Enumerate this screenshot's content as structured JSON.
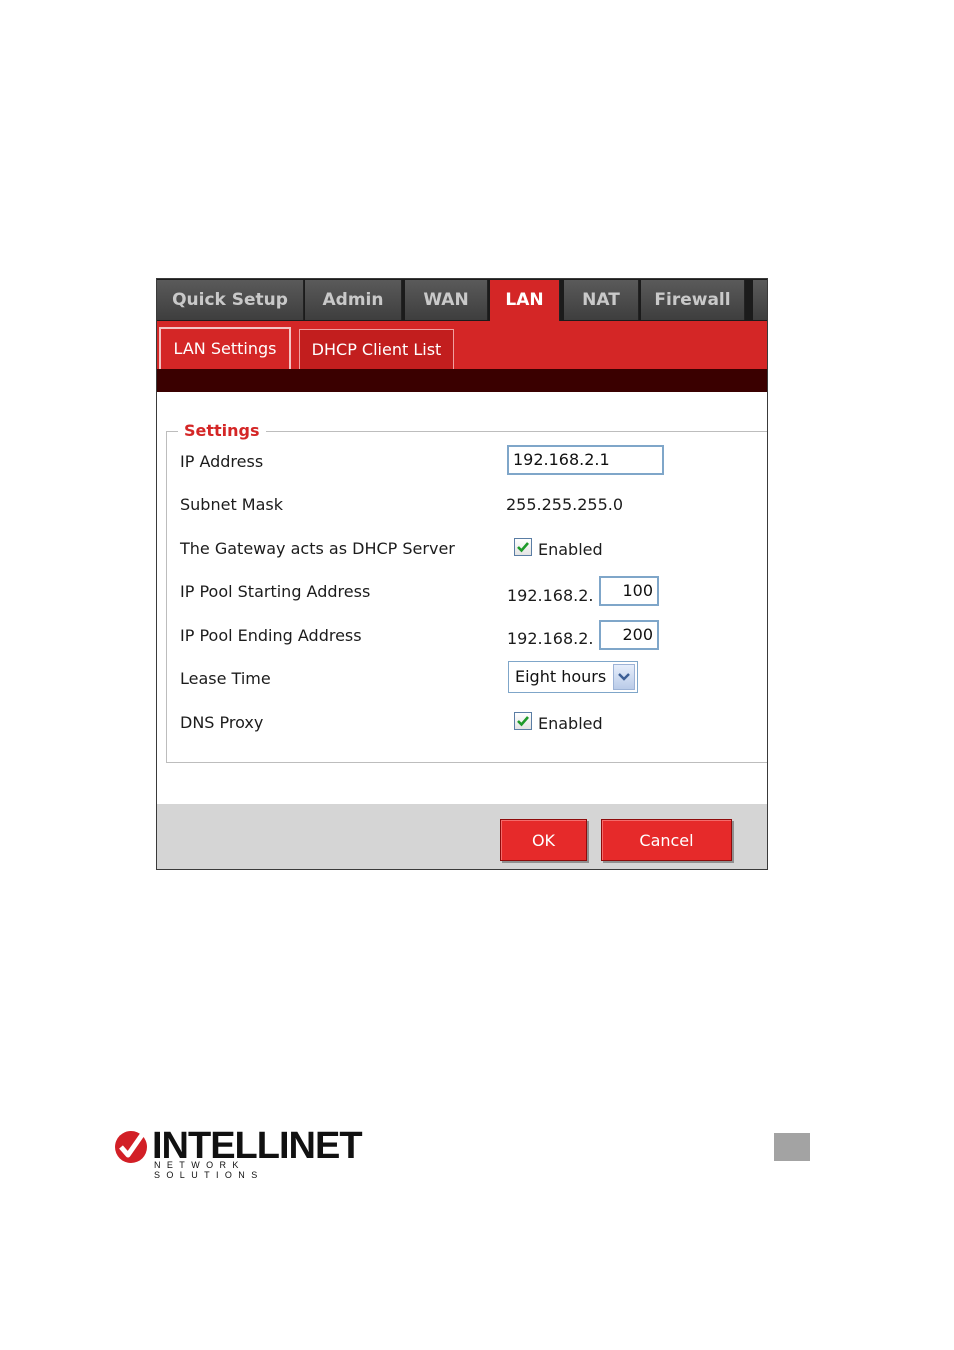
{
  "tabs": [
    "Quick Setup",
    "Admin",
    "WAN",
    "LAN",
    "NAT",
    "Firewall"
  ],
  "active_tab": "LAN",
  "subtabs": [
    "LAN Settings",
    "DHCP Client List"
  ],
  "active_subtab": "LAN Settings",
  "settings": {
    "legend": "Settings",
    "ip_address_label": "IP Address",
    "ip_address_value": "192.168.2.1",
    "subnet_mask_label": "Subnet Mask",
    "subnet_mask_value": "255.255.255.0",
    "dhcp_label": "The Gateway acts as DHCP Server",
    "dhcp_checked": true,
    "dhcp_text": "Enabled",
    "pool_start_label": "IP Pool Starting Address",
    "pool_start_prefix": "192.168.2.",
    "pool_start_value": "100",
    "pool_end_label": "IP Pool Ending Address",
    "pool_end_prefix": "192.168.2.",
    "pool_end_value": "200",
    "lease_label": "Lease Time",
    "lease_value": "Eight hours",
    "dns_label": "DNS Proxy",
    "dns_checked": true,
    "dns_text": "Enabled"
  },
  "buttons": {
    "ok": "OK",
    "cancel": "Cancel"
  },
  "logo": {
    "name": "INTELLINET",
    "tagline": "NETWORK SOLUTIONS"
  },
  "colors": {
    "accent": "#d42626",
    "dark_bar": "#3a0000",
    "tab_bg": "#4a4a4a"
  },
  "icons": {
    "checkbox": "checkmark-icon",
    "dropdown": "chevron-down-icon",
    "logo_mark": "checkmark-circle-icon"
  }
}
